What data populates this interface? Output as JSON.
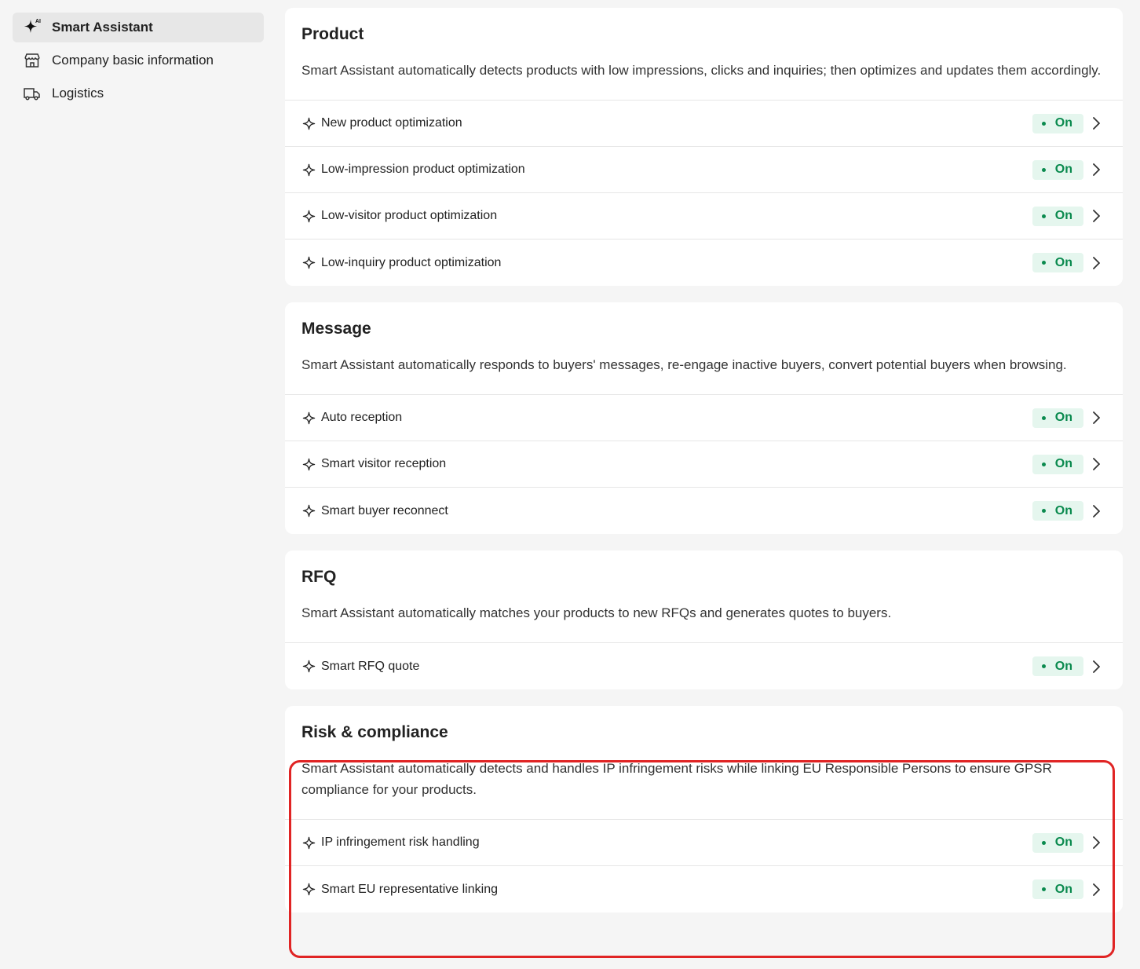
{
  "sidebar": {
    "items": [
      {
        "label": "Smart Assistant",
        "icon": "ai-sparkle-icon",
        "active": true
      },
      {
        "label": "Company basic information",
        "icon": "storefront-icon",
        "active": false
      },
      {
        "label": "Logistics",
        "icon": "truck-icon",
        "active": false
      }
    ]
  },
  "sections": [
    {
      "title": "Product",
      "description": "Smart Assistant automatically detects products with low impressions, clicks and inquiries; then optimizes and updates them accordingly.",
      "rows": [
        {
          "label": "New product optimization",
          "status": "On"
        },
        {
          "label": "Low-impression product optimization",
          "status": "On"
        },
        {
          "label": "Low-visitor product optimization",
          "status": "On"
        },
        {
          "label": "Low-inquiry product optimization",
          "status": "On"
        }
      ]
    },
    {
      "title": "Message",
      "description": "Smart Assistant automatically responds to buyers' messages, re-engage inactive buyers, convert potential buyers when browsing.",
      "rows": [
        {
          "label": "Auto reception",
          "status": "On"
        },
        {
          "label": "Smart visitor reception",
          "status": "On"
        },
        {
          "label": "Smart buyer reconnect",
          "status": "On"
        }
      ]
    },
    {
      "title": "RFQ",
      "description": "Smart Assistant automatically matches your products to new RFQs and generates quotes to buyers.",
      "rows": [
        {
          "label": "Smart RFQ quote",
          "status": "On"
        }
      ]
    },
    {
      "title": "Risk & compliance",
      "description": "Smart Assistant automatically detects and handles IP infringement risks while linking EU Responsible Persons to ensure GPSR compliance for your products.",
      "rows": [
        {
          "label": "IP infringement risk handling",
          "status": "On"
        },
        {
          "label": "Smart EU representative linking",
          "status": "On"
        }
      ]
    }
  ],
  "colors": {
    "status_on_bg": "#e5f6ee",
    "status_on_text": "#0a8a4e",
    "highlight_border": "#e02424"
  }
}
